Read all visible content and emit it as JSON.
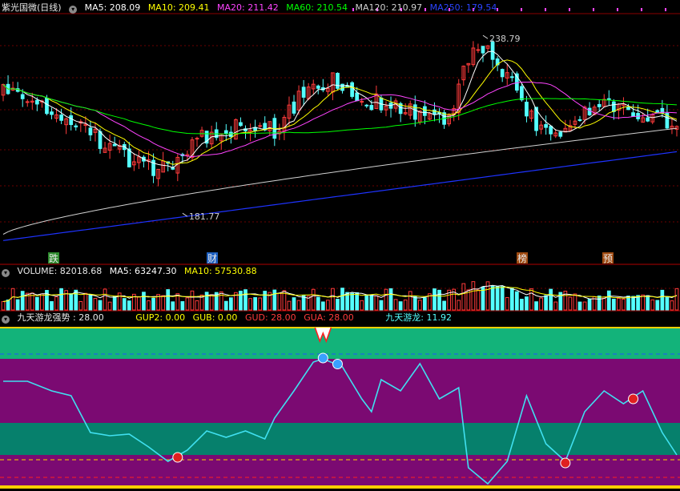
{
  "price_panel": {
    "stock_name": "紫光国微(日线)",
    "ma5": "MA5: 208.09",
    "ma10": "MA10: 209.41",
    "ma20": "MA20: 211.42",
    "ma60": "MA60: 210.54",
    "ma120": "MA120: 210.97",
    "ma250": "MA250: 179.54",
    "high_label": "238.79",
    "low_label": "181.77",
    "markers": [
      "跌",
      "财",
      "榜",
      "预"
    ]
  },
  "volume_panel": {
    "volume": "VOLUME: 82018.68",
    "ma5": "MA5: 63247.30",
    "ma10": "MA10: 57530.88"
  },
  "indicator_panel": {
    "name": "九天游龙强势",
    "value": ": 28.00",
    "gup2": "GUP2: 0.00",
    "gub": "GUB: 0.00",
    "gud": "GUD: 28.00",
    "gua": "GUA: 28.00",
    "jtyl": "九天游龙: 11.92"
  },
  "colors": {
    "up": "#ff3b3b",
    "down": "#54ffff",
    "ma5": "#ffffff",
    "ma10": "#ffff00",
    "ma20": "#ff44ff",
    "ma60": "#00ff00",
    "ma120": "#d0d0d0",
    "ma250": "#1e33ff",
    "band_green": "#13b37a",
    "band_purple": "#7b0a72",
    "band_teal": "#06806c"
  },
  "chart_data": [
    {
      "type": "candlestick",
      "title": "紫光国微(日线)",
      "bars": 140,
      "ylim": [
        170,
        245
      ],
      "high": 238.79,
      "low": 181.77,
      "series": [
        {
          "name": "MA5",
          "last": 208.09
        },
        {
          "name": "MA10",
          "last": 209.41
        },
        {
          "name": "MA20",
          "last": 211.42
        },
        {
          "name": "MA60",
          "last": 210.54
        },
        {
          "name": "MA120",
          "last": 210.97
        },
        {
          "name": "MA250",
          "last": 179.54
        }
      ]
    },
    {
      "type": "bar",
      "title": "VOLUME",
      "last": 82018.68,
      "series": [
        {
          "name": "MA5",
          "last": 63247.3
        },
        {
          "name": "MA10",
          "last": 57530.88
        }
      ]
    },
    {
      "type": "line",
      "title": "九天游龙强势",
      "ylim": [
        0,
        100
      ],
      "bands": [
        {
          "from": 80,
          "to": 100,
          "color": "green"
        },
        {
          "from": 40,
          "to": 80,
          "color": "purple"
        },
        {
          "from": 20,
          "to": 40,
          "color": "teal"
        },
        {
          "from": 0,
          "to": 20,
          "color": "purple"
        }
      ],
      "line": [
        {
          "x": 0,
          "y": 66
        },
        {
          "x": 5,
          "y": 66
        },
        {
          "x": 10,
          "y": 60
        },
        {
          "x": 14,
          "y": 57
        },
        {
          "x": 18,
          "y": 34
        },
        {
          "x": 22,
          "y": 32
        },
        {
          "x": 26,
          "y": 33
        },
        {
          "x": 30,
          "y": 25
        },
        {
          "x": 34,
          "y": 16
        },
        {
          "x": 38,
          "y": 23
        },
        {
          "x": 42,
          "y": 35
        },
        {
          "x": 46,
          "y": 31
        },
        {
          "x": 50,
          "y": 35
        },
        {
          "x": 54,
          "y": 30
        },
        {
          "x": 56,
          "y": 43
        },
        {
          "x": 60,
          "y": 60
        },
        {
          "x": 64,
          "y": 78
        },
        {
          "x": 66,
          "y": 80
        },
        {
          "x": 70,
          "y": 75
        },
        {
          "x": 74,
          "y": 55
        },
        {
          "x": 76,
          "y": 47
        },
        {
          "x": 78,
          "y": 67
        },
        {
          "x": 82,
          "y": 60
        },
        {
          "x": 86,
          "y": 77
        },
        {
          "x": 90,
          "y": 55
        },
        {
          "x": 94,
          "y": 62
        },
        {
          "x": 96,
          "y": 12
        },
        {
          "x": 100,
          "y": 2
        },
        {
          "x": 104,
          "y": 16
        },
        {
          "x": 108,
          "y": 57
        },
        {
          "x": 112,
          "y": 27
        },
        {
          "x": 116,
          "y": 16
        },
        {
          "x": 120,
          "y": 47
        },
        {
          "x": 124,
          "y": 60
        },
        {
          "x": 128,
          "y": 52
        },
        {
          "x": 132,
          "y": 60
        },
        {
          "x": 136,
          "y": 34
        },
        {
          "x": 139,
          "y": 20
        }
      ],
      "signals_up": [
        36,
        116,
        130
      ],
      "signals_down": [
        66,
        69
      ]
    }
  ]
}
